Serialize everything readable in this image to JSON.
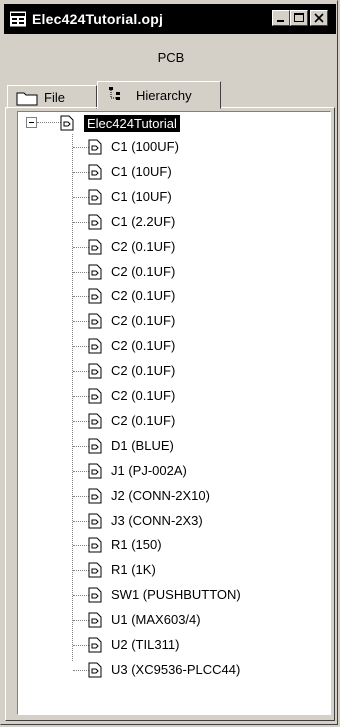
{
  "window": {
    "title": "Elec424Tutorial.opj"
  },
  "panel_header": "PCB",
  "tabs": [
    {
      "label": "File"
    },
    {
      "label": "Hierarchy"
    }
  ],
  "tree": {
    "root": "Elec424Tutorial",
    "items": [
      "C1 (100UF)",
      "C1 (10UF)",
      "C1 (10UF)",
      "C1 (2.2UF)",
      "C2 (0.1UF)",
      "C2 (0.1UF)",
      "C2 (0.1UF)",
      "C2 (0.1UF)",
      "C2 (0.1UF)",
      "C2 (0.1UF)",
      "C2 (0.1UF)",
      "C2 (0.1UF)",
      "D1 (BLUE)",
      "J1 (PJ-002A)",
      "J2 (CONN-2X10)",
      "J3 (CONN-2X3)",
      "R1 (150)",
      "R1 (1K)",
      "SW1 (PUSHBUTTON)",
      "U1 (MAX603/4)",
      "U2 (TIL311)",
      "U3 (XC9536-PLCC44)"
    ]
  }
}
